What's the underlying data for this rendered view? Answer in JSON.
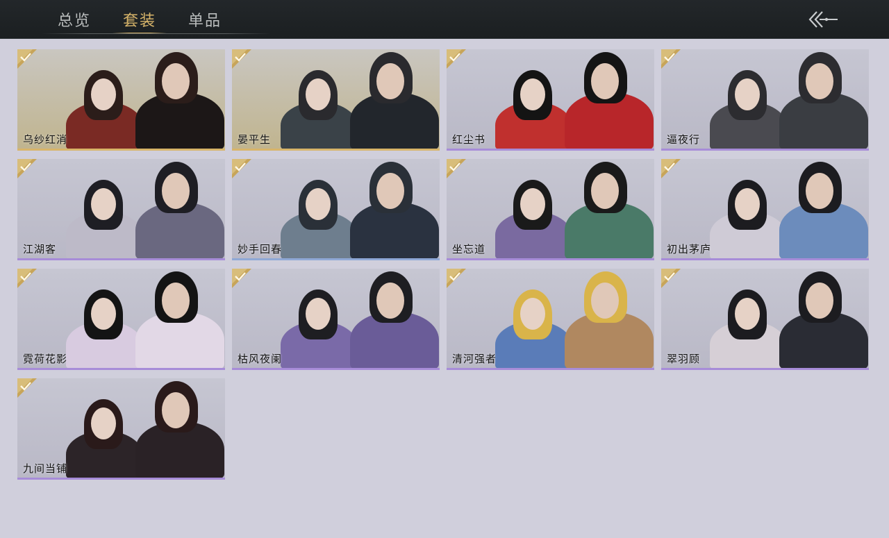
{
  "tabs": [
    {
      "label": "总览",
      "active": false
    },
    {
      "label": "套装",
      "active": true
    },
    {
      "label": "单品",
      "active": false
    }
  ],
  "back_icon": "double-chevron-left-icon",
  "check_icon": "owned-check-icon",
  "sets": [
    {
      "name": "乌纱红消",
      "rarity": "gold"
    },
    {
      "name": "晏平生",
      "rarity": "gold"
    },
    {
      "name": "红尘书",
      "rarity": "purple"
    },
    {
      "name": "逼夜行",
      "rarity": "purple"
    },
    {
      "name": "江湖客",
      "rarity": "purple"
    },
    {
      "name": "妙手回春",
      "rarity": "blue"
    },
    {
      "name": "坐忘道",
      "rarity": "purple"
    },
    {
      "name": "初出茅庐",
      "rarity": "purple"
    },
    {
      "name": "霓荷花影",
      "rarity": "purple"
    },
    {
      "name": "枯风夜阑",
      "rarity": "purple"
    },
    {
      "name": "清河强者",
      "rarity": "purple"
    },
    {
      "name": "翠羽顾",
      "rarity": "purple"
    },
    {
      "name": "九间当铺",
      "rarity": "purple"
    }
  ],
  "colors": {
    "gold": "#d8b56a",
    "purple": "#a78cd8",
    "blue": "#8fa8d6"
  }
}
